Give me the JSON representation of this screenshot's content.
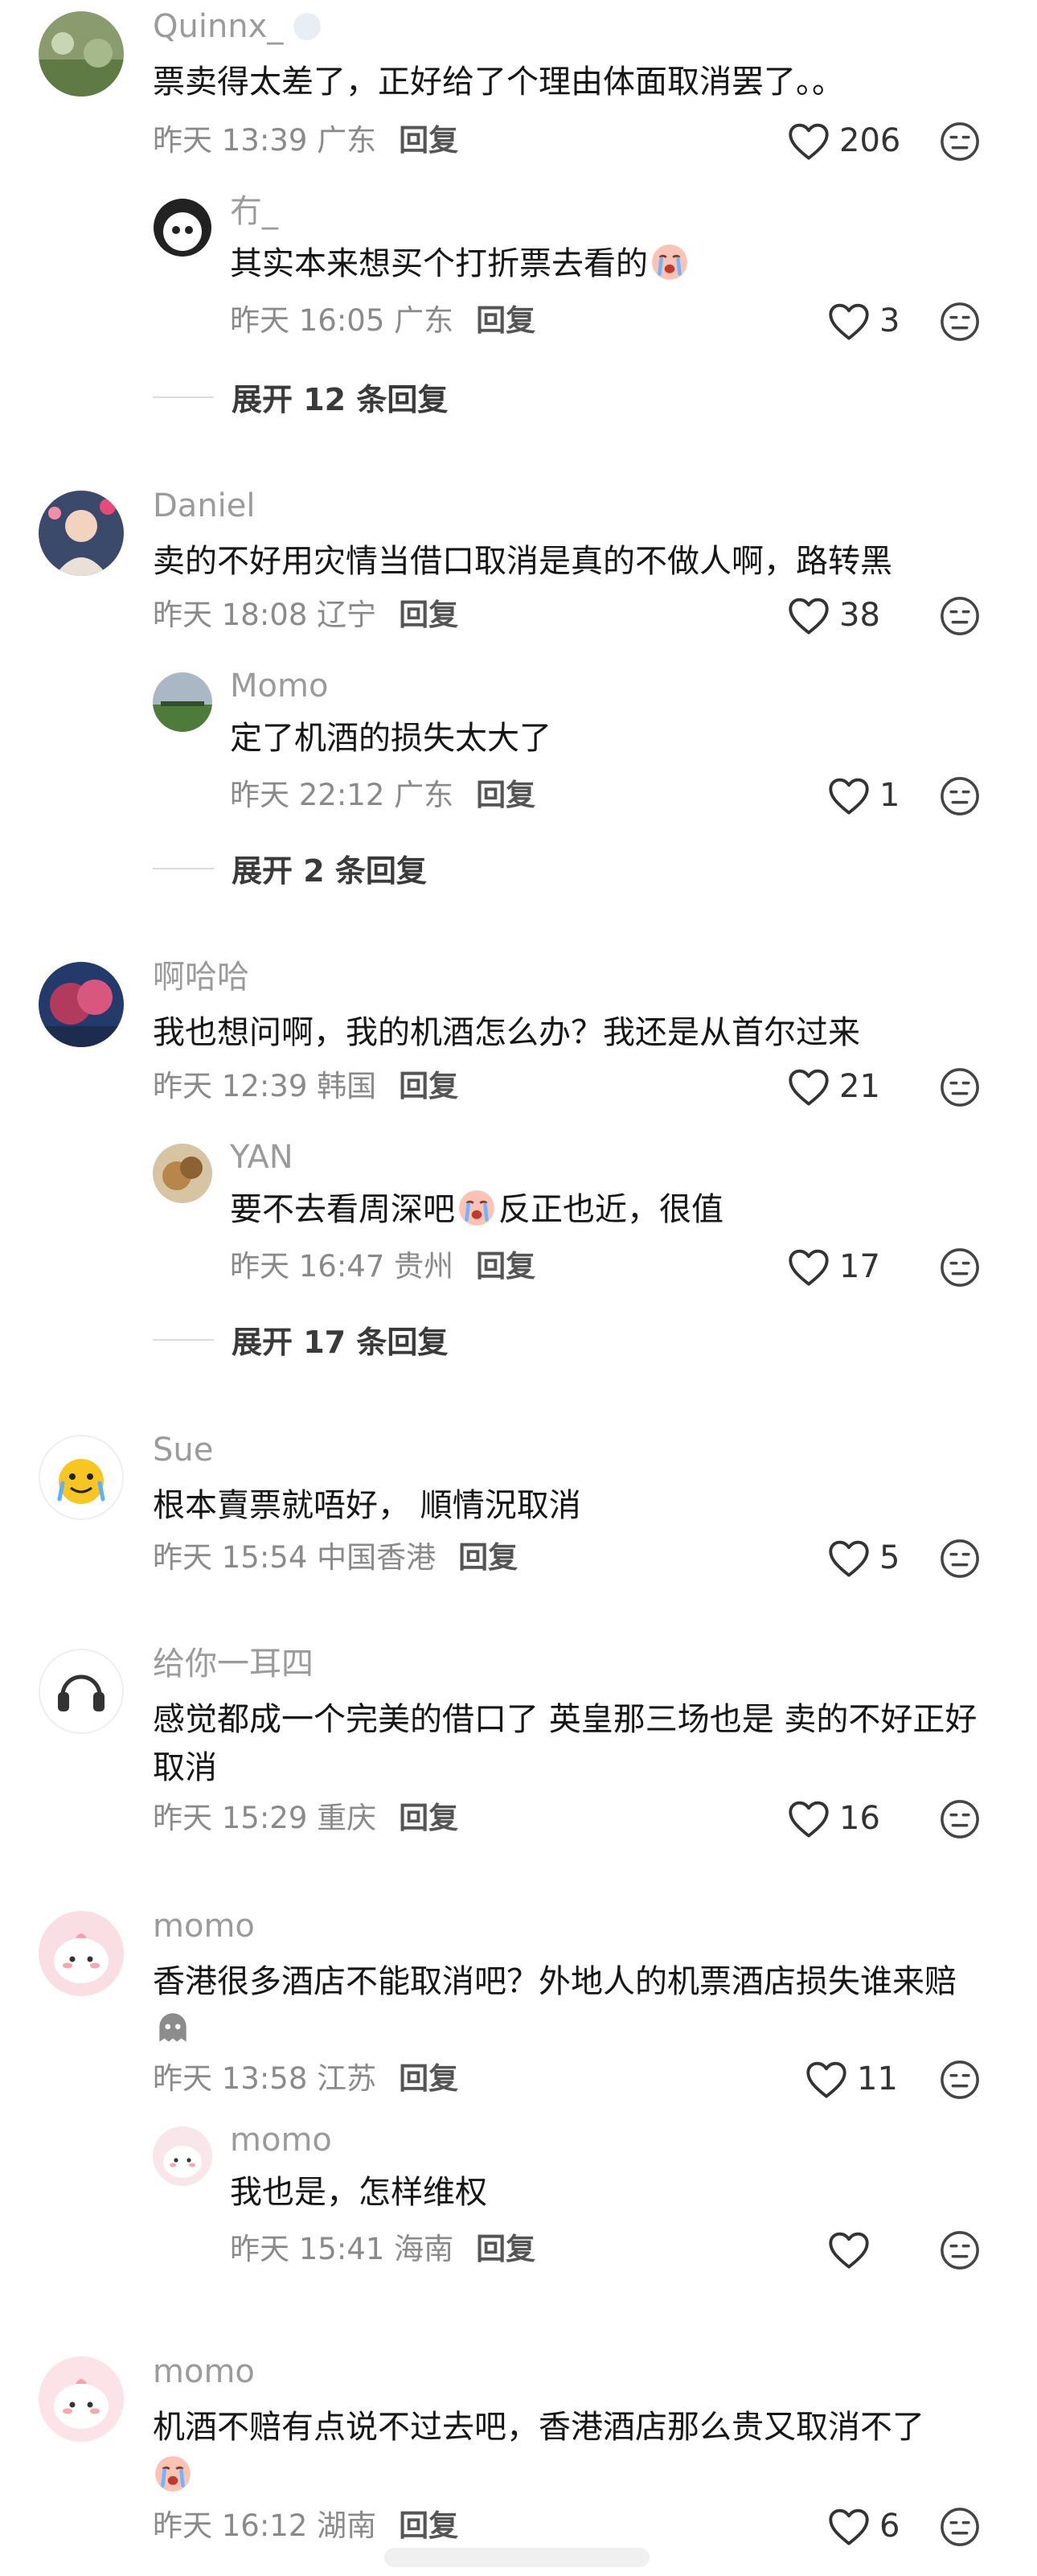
{
  "comments": [
    {
      "name": "Quinnx_",
      "text": "票卖得太差了，正好给了个理由体面取消罢了。。",
      "time": "昨天 13:39",
      "location": "广东",
      "reply_label": "回复",
      "likes": "206"
    },
    {
      "name": "冇_",
      "text_before": "其实本来想买个打折票去看的",
      "time": "昨天 16:05",
      "location": "广东",
      "reply_label": "回复",
      "likes": "3"
    },
    {
      "expand": "展开 12 条回复"
    },
    {
      "name": "Daniel",
      "text": "卖的不好用灾情当借口取消是真的不做人啊，路转黑",
      "time": "昨天 18:08",
      "location": "辽宁",
      "reply_label": "回复",
      "likes": "38"
    },
    {
      "name": "Momo",
      "text": "定了机酒的损失太大了",
      "time": "昨天 22:12",
      "location": "广东",
      "reply_label": "回复",
      "likes": "1"
    },
    {
      "expand": "展开 2 条回复"
    },
    {
      "name": "啊哈哈",
      "text": "我也想问啊，我的机酒怎么办？我还是从首尔过来",
      "time": "昨天 12:39",
      "location": "韩国",
      "reply_label": "回复",
      "likes": "21"
    },
    {
      "name": "YAN",
      "text_before": "要不去看周深吧",
      "text_after": "反正也近，很值",
      "time": "昨天 16:47",
      "location": "贵州",
      "reply_label": "回复",
      "likes": "17"
    },
    {
      "expand": "展开 17 条回复"
    },
    {
      "name": "Sue",
      "text": "根本賣票就唔好， 順情況取消",
      "time": "昨天 15:54",
      "location": "中国香港",
      "reply_label": "回复",
      "likes": "5"
    },
    {
      "name": "给你一耳四",
      "text": "感觉都成一个完美的借口了 英皇那三场也是 卖的不好正好取消",
      "time": "昨天 15:29",
      "location": "重庆",
      "reply_label": "回复",
      "likes": "16"
    },
    {
      "name": "momo",
      "text": "香港很多酒店不能取消吧？外地人的机票酒店损失谁来赔",
      "time": "昨天 13:58",
      "location": "江苏",
      "reply_label": "回复",
      "likes": "11"
    },
    {
      "name": "momo",
      "text": "我也是，怎样维权",
      "time": "昨天 15:41",
      "location": "海南",
      "reply_label": "回复",
      "likes": ""
    },
    {
      "name": "momo",
      "text": "机酒不赔有点说不过去吧，香港酒店那么贵又取消不了",
      "time": "昨天 16:12",
      "location": "湖南",
      "reply_label": "回复",
      "likes": "6"
    }
  ],
  "colors": {
    "name": "#9b9b9b",
    "text": "#161616",
    "meta": "#8a8a8a",
    "background": "#ffffff"
  },
  "icons": {
    "like": "heart-outline-icon",
    "dislike": "neutral-face-icon",
    "emoji": "crying-face-emoji"
  }
}
